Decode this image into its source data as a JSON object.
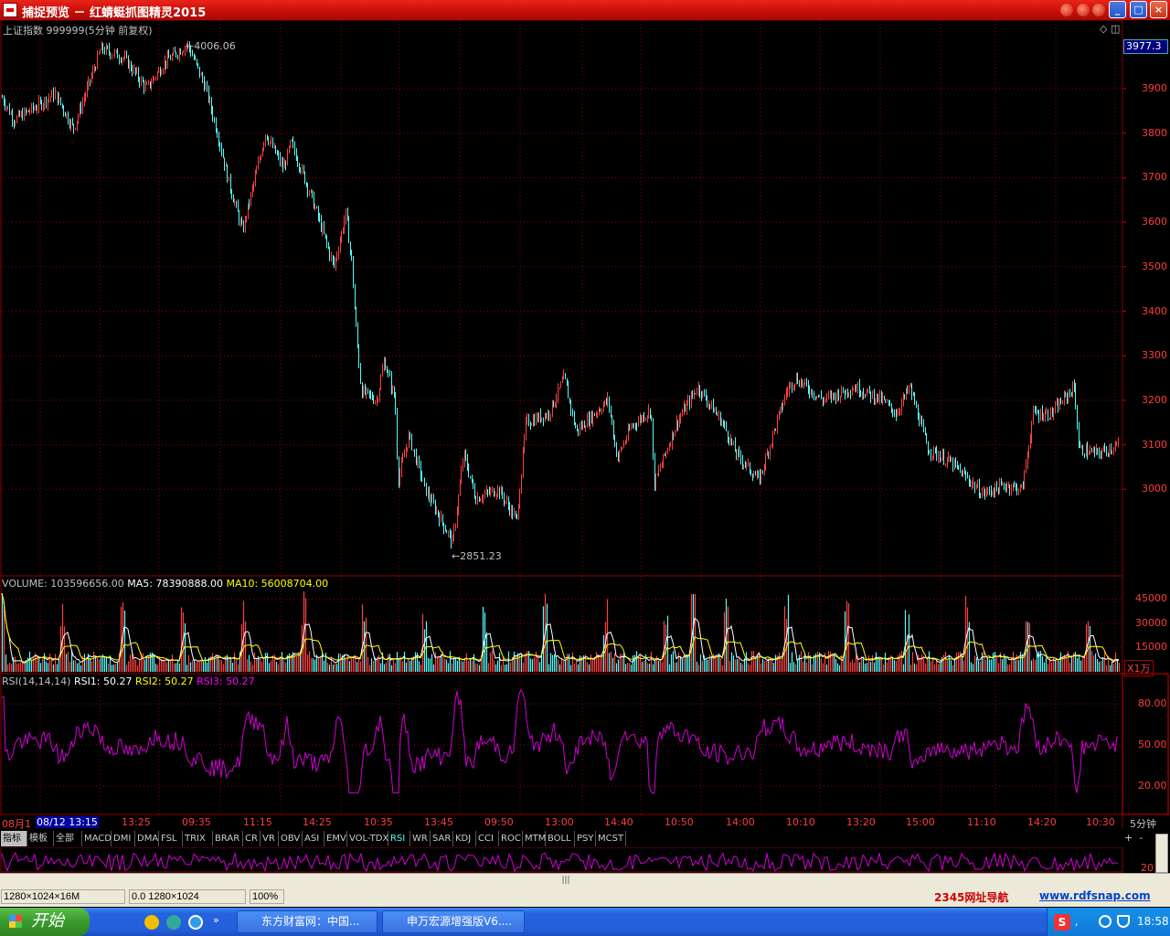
{
  "window": {
    "title": "捕捉预览 － 红蜻蜓抓图精灵2015"
  },
  "chart": {
    "header": "上证指数 999999(5分钟 前复权)",
    "current_price": "3977.3",
    "high_label": "4006.06",
    "low_label": "2851.23",
    "price_ticks": [
      "3900",
      "3800",
      "3700",
      "3600",
      "3500",
      "3400",
      "3300",
      "3200",
      "3100",
      "3000"
    ],
    "volume_header": {
      "prefix": "VOLUME: 103596656.00",
      "ma5": "MA5: 78390888.00",
      "ma10": "MA10: 56008704.00"
    },
    "volume_ticks": [
      "45000",
      "30000",
      "15000"
    ],
    "volume_unit": "X1万",
    "rsi_header": {
      "prefix": "RSI(14,14,14)",
      "rsi1": "RSI1: 50.27",
      "rsi2": "RSI2: 50.27",
      "rsi3": "RSI3: 50.27"
    },
    "rsi_ticks": [
      "80.00",
      "50.00",
      "20.00"
    ],
    "rsi_ticks_mini": [
      "20"
    ],
    "time_axis": [
      "08月1",
      "08/12 13:15",
      "13:25",
      "09:35",
      "11:15",
      "14:25",
      "10:35",
      "13:45",
      "09:50",
      "13:00",
      "14:40",
      "10:50",
      "14:00",
      "10:10",
      "13:20",
      "15:00",
      "11:10",
      "14:20",
      "10:30"
    ],
    "period": "5分钟",
    "colors": {
      "up": "#ff4040",
      "down": "#54fcfc",
      "grid": "#8b0000",
      "rsi": "#d200d2",
      "ma5": "#ffffff",
      "ma10": "#ffff00"
    }
  },
  "indicator_tabs": [
    "指标",
    "模板",
    "全部",
    "MACD",
    "DMI",
    "DMA",
    "FSL",
    "TRIX",
    "BRAR",
    "CR",
    "VR",
    "OBV",
    "ASI",
    "EMV",
    "VOL-TDX",
    "RSI",
    "WR",
    "SAR",
    "KDJ",
    "CCI",
    "ROC",
    "MTM",
    "BOLL",
    "PSY",
    "MCST"
  ],
  "active_tab": "RSI",
  "status": {
    "resolution": "1280×1024×16M",
    "coords": "0.0 1280×1024",
    "zoom": "100%",
    "link1": "2345网址导航",
    "link2": "www.rdfsnap.com"
  },
  "taskbar": {
    "start": "开始",
    "tasks": [
      "东方财富网：中国...",
      "申万宏源增强版V6...."
    ],
    "clock": "18:58"
  }
}
